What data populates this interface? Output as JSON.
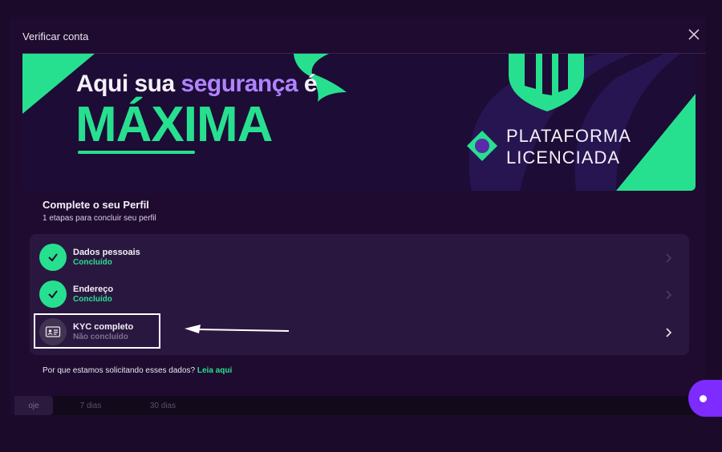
{
  "modal": {
    "title": "Verificar conta",
    "close_icon": "close-icon"
  },
  "banner": {
    "line1_prefix": "Aqui sua ",
    "line1_accent": "segurança",
    "line1_suffix": " é",
    "line2": "MÁXIMA",
    "platform_line1": "PLATAFORMA",
    "platform_line2": "LICENCIADA",
    "colors": {
      "green": "#27e08f",
      "purple": "#b084ff",
      "bg": "#1d0c36"
    }
  },
  "profile": {
    "title": "Complete o seu Perfil",
    "subtitle": "1 etapas para concluir seu perfil",
    "steps": [
      {
        "title": "Dados pessoais",
        "status": "Concluído",
        "done": true,
        "icon": "check-icon"
      },
      {
        "title": "Endereço",
        "status": "Concluído",
        "done": true,
        "icon": "check-icon"
      },
      {
        "title": "KYC completo",
        "status": "Não concluído",
        "done": false,
        "icon": "id-card-icon"
      }
    ]
  },
  "footer": {
    "question": "Por que estamos solicitando esses dados? ",
    "link": "Leia aqui"
  },
  "background_tabs": [
    "oje",
    "7 dias",
    "30 dias"
  ]
}
